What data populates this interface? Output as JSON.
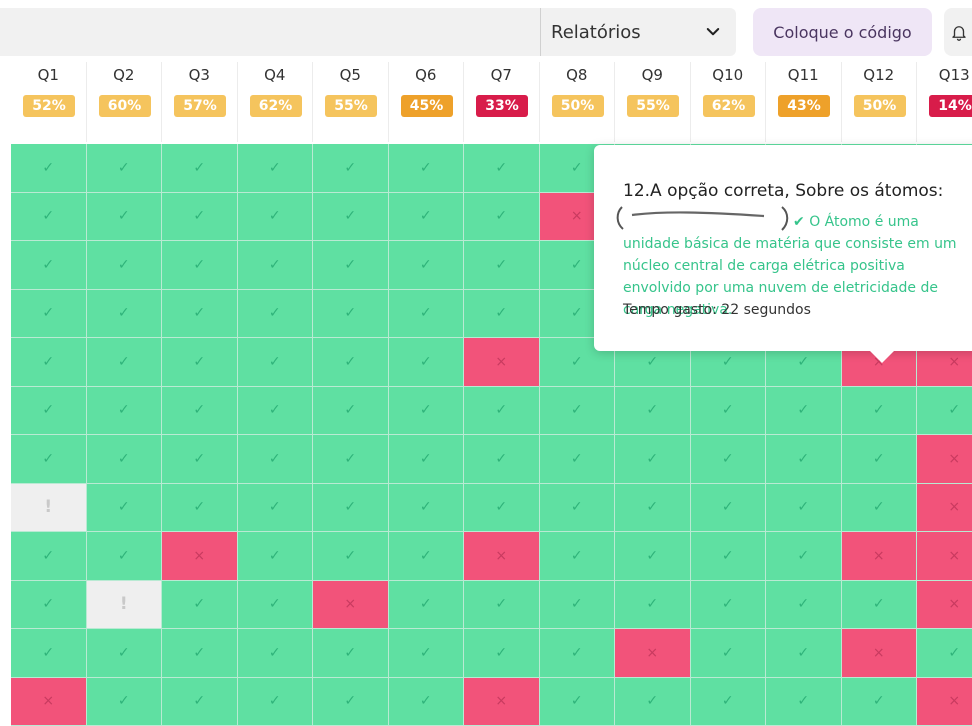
{
  "topbar": {
    "reports_label": "Relatórios",
    "code_button_label": "Coloque o código"
  },
  "questions": [
    {
      "label": "Q1",
      "pct": "52%",
      "color": "#f5c45d"
    },
    {
      "label": "Q2",
      "pct": "60%",
      "color": "#f5c45d"
    },
    {
      "label": "Q3",
      "pct": "57%",
      "color": "#f5c45d"
    },
    {
      "label": "Q4",
      "pct": "62%",
      "color": "#f5c45d"
    },
    {
      "label": "Q5",
      "pct": "55%",
      "color": "#f5c45d"
    },
    {
      "label": "Q6",
      "pct": "45%",
      "color": "#eea12a"
    },
    {
      "label": "Q7",
      "pct": "33%",
      "color": "#d81c4a"
    },
    {
      "label": "Q8",
      "pct": "50%",
      "color": "#f5c45d"
    },
    {
      "label": "Q9",
      "pct": "55%",
      "color": "#f5c45d"
    },
    {
      "label": "Q10",
      "pct": "62%",
      "color": "#f5c45d"
    },
    {
      "label": "Q11",
      "pct": "43%",
      "color": "#eea12a"
    },
    {
      "label": "Q12",
      "pct": "50%",
      "color": "#f5c45d"
    },
    {
      "label": "Q13",
      "pct": "14%",
      "color": "#d81c4a"
    }
  ],
  "symbols": {
    "correct": "✓",
    "wrong": "×",
    "unanswered": "!"
  },
  "grid": [
    [
      "c",
      "c",
      "c",
      "c",
      "c",
      "c",
      "c",
      "c",
      "c",
      "c",
      "c",
      "c",
      "c"
    ],
    [
      "c",
      "c",
      "c",
      "c",
      "c",
      "c",
      "c",
      "w",
      "c",
      "c",
      "c",
      "c",
      "c"
    ],
    [
      "c",
      "c",
      "c",
      "c",
      "c",
      "c",
      "c",
      "c",
      "c",
      "c",
      "c",
      "c",
      "c"
    ],
    [
      "c",
      "c",
      "c",
      "c",
      "c",
      "c",
      "c",
      "c",
      "c",
      "c",
      "c",
      "c",
      "c"
    ],
    [
      "c",
      "c",
      "c",
      "c",
      "c",
      "c",
      "w",
      "c",
      "c",
      "c",
      "c",
      "w",
      "w"
    ],
    [
      "c",
      "c",
      "c",
      "c",
      "c",
      "c",
      "c",
      "c",
      "c",
      "c",
      "c",
      "c",
      "c"
    ],
    [
      "c",
      "c",
      "c",
      "c",
      "c",
      "c",
      "c",
      "c",
      "c",
      "c",
      "c",
      "c",
      "w"
    ],
    [
      "u",
      "c",
      "c",
      "c",
      "c",
      "c",
      "c",
      "c",
      "c",
      "c",
      "c",
      "c",
      "w"
    ],
    [
      "c",
      "c",
      "w",
      "c",
      "c",
      "c",
      "w",
      "c",
      "c",
      "c",
      "c",
      "w",
      "w"
    ],
    [
      "c",
      "u",
      "c",
      "c",
      "w",
      "c",
      "c",
      "c",
      "c",
      "c",
      "c",
      "c",
      "w"
    ],
    [
      "c",
      "c",
      "c",
      "c",
      "c",
      "c",
      "c",
      "c",
      "w",
      "c",
      "c",
      "w",
      "c"
    ],
    [
      "w",
      "c",
      "c",
      "c",
      "c",
      "c",
      "w",
      "c",
      "c",
      "c",
      "c",
      "c",
      "w"
    ]
  ],
  "tooltip": {
    "title": "12.A opção correta, Sobre os átomos:",
    "answer": "O Átomo é uma unidade básica de matéria que consiste em um núcleo central de carga elétrica positiva envolvido por uma nuvem de eletricidade de carga negativa.",
    "time": "Tempo gasto: 22 segundos"
  }
}
